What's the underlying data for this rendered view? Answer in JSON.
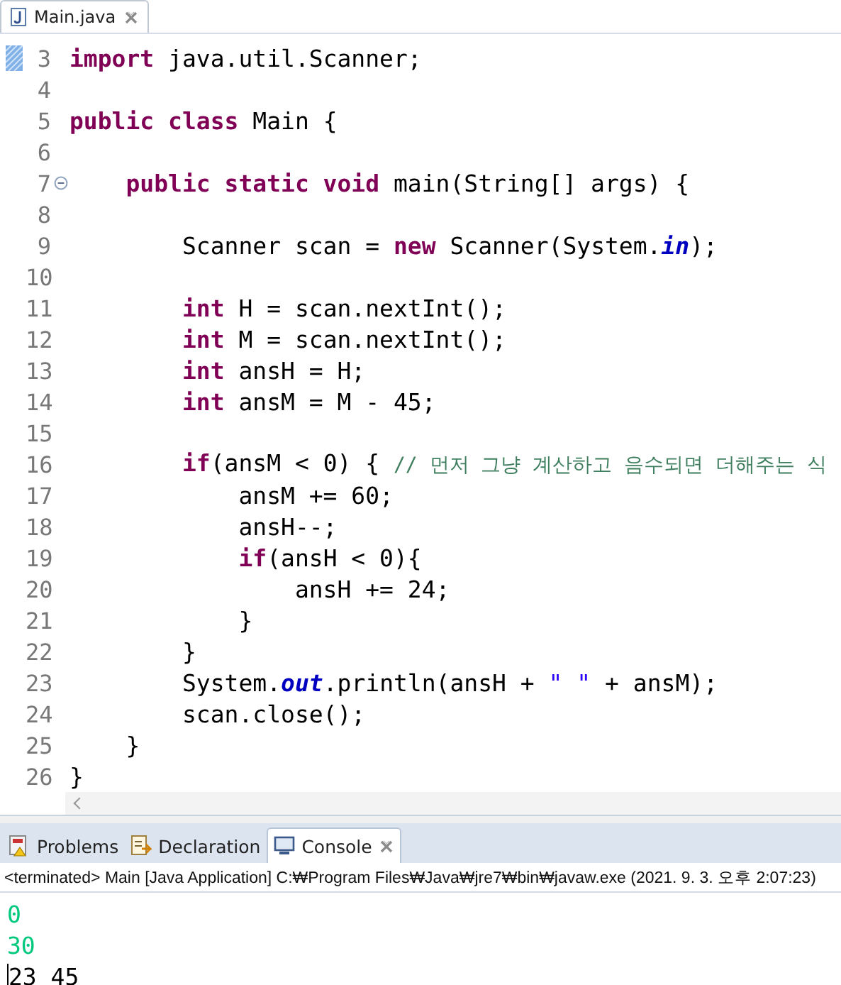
{
  "editor_tab": {
    "label": "Main.java",
    "selected": true
  },
  "code_lines": [
    {
      "number": "3",
      "tokens": [
        {
          "kind": "keyword",
          "text": "import"
        },
        {
          "kind": "plain",
          "text": " java.util.Scanner;"
        }
      ]
    },
    {
      "number": "4"
    },
    {
      "number": "5",
      "tokens": [
        {
          "kind": "keyword",
          "text": "public class"
        },
        {
          "kind": "plain",
          "text": " Main {"
        }
      ]
    },
    {
      "number": "6"
    },
    {
      "number": "7",
      "collapsed": false,
      "tokens": [
        {
          "kind": "keyword",
          "text": "    public static void"
        },
        {
          "kind": "plain",
          "text": " main(String[] args) {"
        }
      ]
    },
    {
      "number": "8"
    },
    {
      "number": "9",
      "tokens": [
        {
          "kind": "plain",
          "text": "        Scanner scan = "
        },
        {
          "kind": "keyword",
          "text": "new"
        },
        {
          "kind": "plain",
          "text": " Scanner(System."
        },
        {
          "kind": "static",
          "text": "in"
        },
        {
          "kind": "plain",
          "text": ");"
        }
      ]
    },
    {
      "number": "10"
    },
    {
      "number": "11",
      "tokens": [
        {
          "kind": "keyword",
          "text": "        int"
        },
        {
          "kind": "plain",
          "text": " H = scan.nextInt();"
        }
      ]
    },
    {
      "number": "12",
      "tokens": [
        {
          "kind": "keyword",
          "text": "        int"
        },
        {
          "kind": "plain",
          "text": " M = scan.nextInt();"
        }
      ]
    },
    {
      "number": "13",
      "tokens": [
        {
          "kind": "keyword",
          "text": "        int"
        },
        {
          "kind": "plain",
          "text": " ansH = H;"
        }
      ]
    },
    {
      "number": "14",
      "tokens": [
        {
          "kind": "keyword",
          "text": "        int"
        },
        {
          "kind": "plain",
          "text": " ansM = M - 45;"
        }
      ]
    },
    {
      "number": "15"
    },
    {
      "number": "16",
      "tokens": [
        {
          "kind": "keyword",
          "text": "        if"
        },
        {
          "kind": "plain",
          "text": "(ansM < 0) { "
        },
        {
          "kind": "comment",
          "text": "// 먼저 그냥 계산하고 음수되면 더해주는 식"
        }
      ]
    },
    {
      "number": "17",
      "tokens": [
        {
          "kind": "plain",
          "text": "            ansM += 60;"
        }
      ]
    },
    {
      "number": "18",
      "tokens": [
        {
          "kind": "plain",
          "text": "            ansH--;"
        }
      ]
    },
    {
      "number": "19",
      "tokens": [
        {
          "kind": "keyword",
          "text": "            if"
        },
        {
          "kind": "plain",
          "text": "(ansH < 0){"
        }
      ]
    },
    {
      "number": "20",
      "tokens": [
        {
          "kind": "plain",
          "text": "                ansH += 24;"
        }
      ]
    },
    {
      "number": "21",
      "tokens": [
        {
          "kind": "plain",
          "text": "            }"
        }
      ]
    },
    {
      "number": "22",
      "tokens": [
        {
          "kind": "plain",
          "text": "        }"
        }
      ]
    },
    {
      "number": "23",
      "tokens": [
        {
          "kind": "plain",
          "text": "        System."
        },
        {
          "kind": "static",
          "text": "out"
        },
        {
          "kind": "plain",
          "text": ".println(ansH + "
        },
        {
          "kind": "string",
          "text": "\" \""
        },
        {
          "kind": "plain",
          "text": " + ansM);"
        }
      ]
    },
    {
      "number": "24",
      "tokens": [
        {
          "kind": "plain",
          "text": "        scan.close();"
        }
      ]
    },
    {
      "number": "25",
      "tokens": [
        {
          "kind": "plain",
          "text": "    }"
        }
      ]
    },
    {
      "number": "26",
      "tokens": [
        {
          "kind": "plain",
          "text": "}"
        }
      ]
    }
  ],
  "panel_tabs": [
    {
      "label": "Problems",
      "selected": false
    },
    {
      "label": "Declaration",
      "selected": false
    },
    {
      "label": "Console",
      "selected": true
    }
  ],
  "console": {
    "header": "<terminated> Main [Java Application] C:₩Program Files₩Java₩jre7₩bin₩javaw.exe (2021. 9. 3. 오후 2:07:23)",
    "lines": [
      {
        "kind": "input",
        "text": "0"
      },
      {
        "kind": "input",
        "text": "30"
      },
      {
        "kind": "output",
        "text": "23 45"
      }
    ]
  }
}
